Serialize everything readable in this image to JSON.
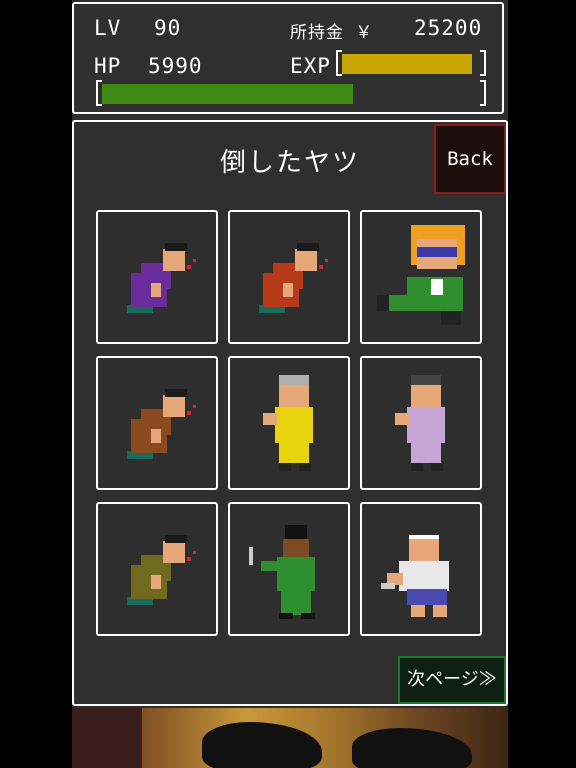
{
  "status": {
    "level_label": "LV",
    "level_value": "90",
    "money_label": "所持金 ￥",
    "money_value": "25200",
    "hp_label": "HP",
    "hp_value": "5990",
    "exp_label": "EXP",
    "exp_fraction": 0.93,
    "hp_fraction": 0.66,
    "exp_color": "#c7a700",
    "hp_color": "#3f8a14"
  },
  "main": {
    "title": "倒したヤツ",
    "back_label": "Back",
    "next_label": "次ページ≫"
  },
  "defeated": [
    {
      "name": "purple-gang-knocked-out",
      "color": "#6a2c9a",
      "pose": "down"
    },
    {
      "name": "red-blond-gang-knocked-out",
      "color": "#b63a17",
      "pose": "down"
    },
    {
      "name": "blond-sunglasses-boss",
      "color": "#2f8f2f",
      "pose": "boss"
    },
    {
      "name": "brown-bald-gang-knocked-out",
      "color": "#8a4a1e",
      "pose": "down"
    },
    {
      "name": "grey-haired-yellow-fighter",
      "color": "#e8d40c",
      "pose": "stand"
    },
    {
      "name": "afro-lavender-fighter",
      "color": "#c7a6d6",
      "pose": "stand"
    },
    {
      "name": "olive-gang-knocked-out",
      "color": "#6f6a1e",
      "pose": "down"
    },
    {
      "name": "green-knife-fighter",
      "color": "#2f8f2f",
      "pose": "knife"
    },
    {
      "name": "headband-brawler",
      "color": "#e8e8f0",
      "pose": "brawler"
    }
  ]
}
